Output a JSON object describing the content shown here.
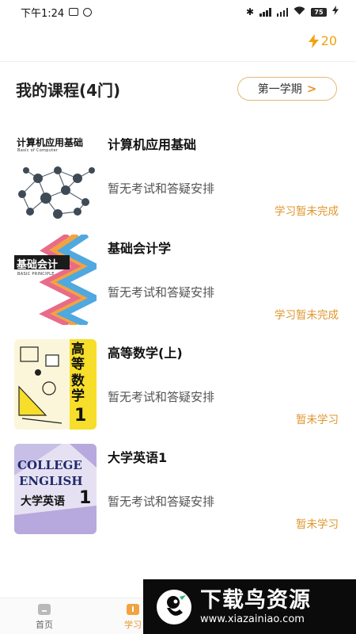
{
  "status_bar": {
    "time": "下午1:24",
    "battery": "75"
  },
  "energy": {
    "value": "20",
    "icon": "lightning-icon"
  },
  "header": {
    "title": "我的课程(4门)",
    "semester_label": "第一学期",
    "semester_chevron": ">"
  },
  "courses": [
    {
      "name": "计算机应用基础",
      "cover_title": "计算机应用基础",
      "cover_subtitle": "Basic of Computer",
      "exam_note": "暂无考试和答疑安排",
      "status": "学习暂未完成"
    },
    {
      "name": "基础会计学",
      "cover_title": "基础会计",
      "cover_subtitle": "BASIC PRINCIPLE",
      "exam_note": "暂无考试和答疑安排",
      "status": "学习暂未完成"
    },
    {
      "name": "高等数学(上)",
      "cover_title_1": "高等",
      "cover_title_2": "数学",
      "cover_title_3": "1",
      "exam_note": "暂无考试和答疑安排",
      "status": "暂未学习"
    },
    {
      "name": "大学英语1",
      "cover_title_1": "COLLEGE",
      "cover_title_2": "ENGLISH",
      "cover_title_3": "大学英语",
      "cover_title_4": "1",
      "exam_note": "暂无考试和答疑安排",
      "status": "暂未学习"
    }
  ],
  "bottom_nav": {
    "items": [
      {
        "label": "首页",
        "icon": "home-icon"
      },
      {
        "label": "学习",
        "icon": "study-icon"
      }
    ]
  },
  "watermark": {
    "big": "下载鸟资源",
    "small": "www.xiazainiao.com"
  },
  "colors": {
    "accent": "#e8962a",
    "energy": "#f2a20c",
    "pill_border": "#e5b878"
  }
}
